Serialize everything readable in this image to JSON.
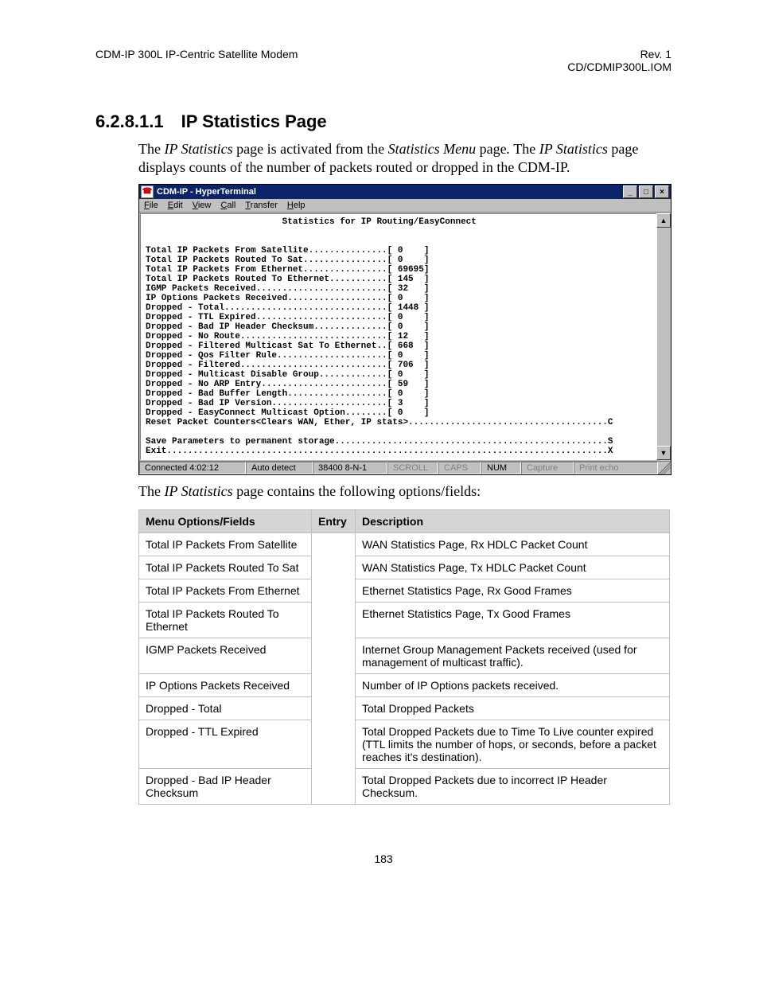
{
  "header": {
    "left": "CDM-IP 300L IP-Centric Satellite Modem",
    "right1": "Rev. 1",
    "right2": "CD/CDMIP300L.IOM"
  },
  "heading": {
    "number": "6.2.8.1.1",
    "title": "IP Statistics Page"
  },
  "intro_html": "The <em>IP Statistics</em> page is activated from the <em>Statistics Menu</em> page<em>.</em> The <em>IP Statistics</em> page displays counts of the number of packets routed or dropped in the CDM-IP.",
  "terminal": {
    "window_title": "CDM-IP - HyperTerminal",
    "menus": [
      "File",
      "Edit",
      "View",
      "Call",
      "Transfer",
      "Help"
    ],
    "screen_title": "Statistics for IP Routing/EasyConnect",
    "stats": [
      {
        "label": "Total IP Packets From Satellite",
        "value": "0"
      },
      {
        "label": "Total IP Packets Routed To Sat",
        "value": "0"
      },
      {
        "label": "Total IP Packets From Ethernet",
        "value": "69695"
      },
      {
        "label": "Total IP Packets Routed To Ethernet",
        "value": "145"
      },
      {
        "label": "IGMP Packets Received",
        "value": "32"
      },
      {
        "label": "IP Options Packets Received",
        "value": "0"
      },
      {
        "label": "Dropped - Total",
        "value": "1448"
      },
      {
        "label": "Dropped - TTL Expired",
        "value": "0"
      },
      {
        "label": "Dropped - Bad IP Header Checksum",
        "value": "0"
      },
      {
        "label": "Dropped - No Route",
        "value": "12"
      },
      {
        "label": "Dropped - Filtered Multicast Sat To Ethernet",
        "value": "668"
      },
      {
        "label": "Dropped - Qos Filter Rule",
        "value": "0"
      },
      {
        "label": "Dropped - Filtered",
        "value": "706"
      },
      {
        "label": "Dropped - Multicast Disable Group",
        "value": "0"
      },
      {
        "label": "Dropped - No ARP Entry",
        "value": "59"
      },
      {
        "label": "Dropped - Bad Buffer Length",
        "value": "0"
      },
      {
        "label": "Dropped - Bad IP Version",
        "value": "3"
      },
      {
        "label": "Dropped - EasyConnect Multicast Option",
        "value": "0"
      }
    ],
    "commands": [
      {
        "label": "Reset Packet Counters<Clears WAN, Ether, IP stats>",
        "key": "C"
      },
      {
        "label": "Save Parameters to permanent storage",
        "key": "S"
      },
      {
        "label": "Exit",
        "key": "X"
      }
    ],
    "status": {
      "conn": "Connected 4:02:12",
      "detect": "Auto detect",
      "port": "38400 8-N-1",
      "indicators": [
        "SCROLL",
        "CAPS",
        "NUM",
        "Capture",
        "Print echo"
      ]
    }
  },
  "caption_html": "The <em>IP Statistics</em> page contains the following options/fields:",
  "table": {
    "headers": [
      "Menu Options/Fields",
      "Entry",
      "Description"
    ],
    "rows": [
      {
        "name": "Total IP Packets From Satellite",
        "entry": "",
        "desc": "WAN Statistics Page, Rx HDLC Packet Count"
      },
      {
        "name": "Total IP Packets Routed To Sat",
        "entry": "",
        "desc": "WAN Statistics Page, Tx HDLC Packet Count"
      },
      {
        "name": "Total IP Packets From Ethernet",
        "entry": "",
        "desc": "Ethernet Statistics Page, Rx Good Frames"
      },
      {
        "name": "Total IP Packets Routed To Ethernet",
        "entry": "",
        "desc": "Ethernet Statistics Page, Tx Good Frames"
      },
      {
        "name": "IGMP Packets Received",
        "entry": "",
        "desc": "Internet Group Management Packets received (used for management of multicast traffic)."
      },
      {
        "name": "IP Options Packets Received",
        "entry": "",
        "desc": "Number of IP Options packets received."
      },
      {
        "name": "Dropped - Total",
        "entry": "",
        "desc": "Total Dropped Packets"
      },
      {
        "name": "Dropped - TTL Expired",
        "entry": "",
        "desc": "Total Dropped Packets due to Time To Live counter expired (TTL limits the number of hops, or seconds, before a packet reaches it's destination)."
      },
      {
        "name": "Dropped - Bad IP Header Checksum",
        "entry": "",
        "desc": "Total Dropped Packets due to incorrect IP Header Checksum."
      }
    ]
  },
  "page_number": "183"
}
